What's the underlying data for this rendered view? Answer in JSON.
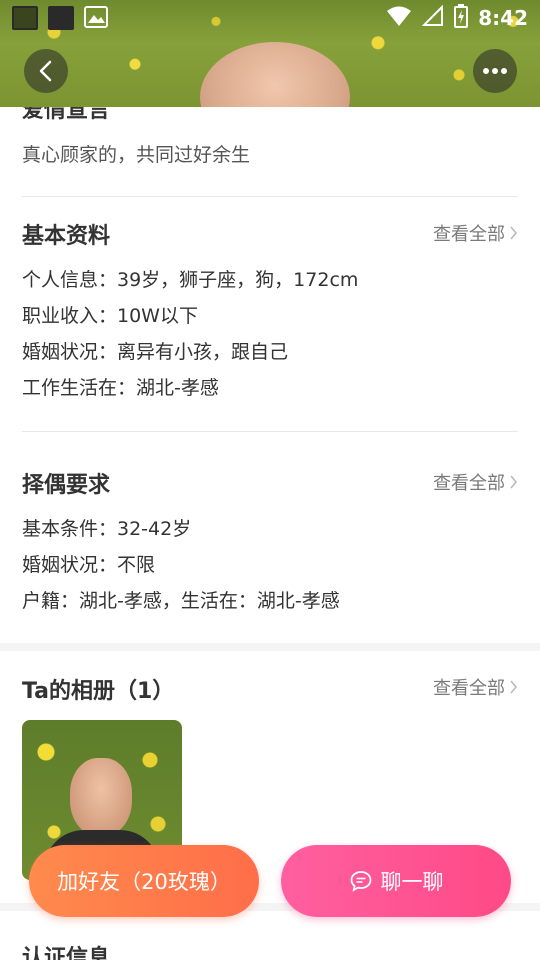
{
  "status_bar": {
    "time": "8:42"
  },
  "header": {
    "back_icon": "chevron-left-icon",
    "more_icon": "more-icon"
  },
  "love_declaration": {
    "title": "爱情宣言",
    "text": "真心顾家的，共同过好余生"
  },
  "basic_info": {
    "title": "基本资料",
    "see_all": "查看全部",
    "lines": [
      "个人信息：39岁，狮子座，狗，172cm",
      "职业收入：10W以下",
      "婚姻状况：离异有小孩，跟自己",
      "工作生活在：湖北-孝感"
    ]
  },
  "partner_requirements": {
    "title": "择偶要求",
    "see_all": "查看全部",
    "lines": [
      "基本条件：32-42岁",
      "婚姻状况：不限",
      "户籍：湖北-孝感，生活在：湖北-孝感"
    ]
  },
  "album": {
    "title": "Ta的相册（1）",
    "see_all": "查看全部"
  },
  "verification": {
    "title": "认证信息"
  },
  "actions": {
    "add_friend": "加好友（20玫瑰）",
    "chat": "聊一聊"
  }
}
